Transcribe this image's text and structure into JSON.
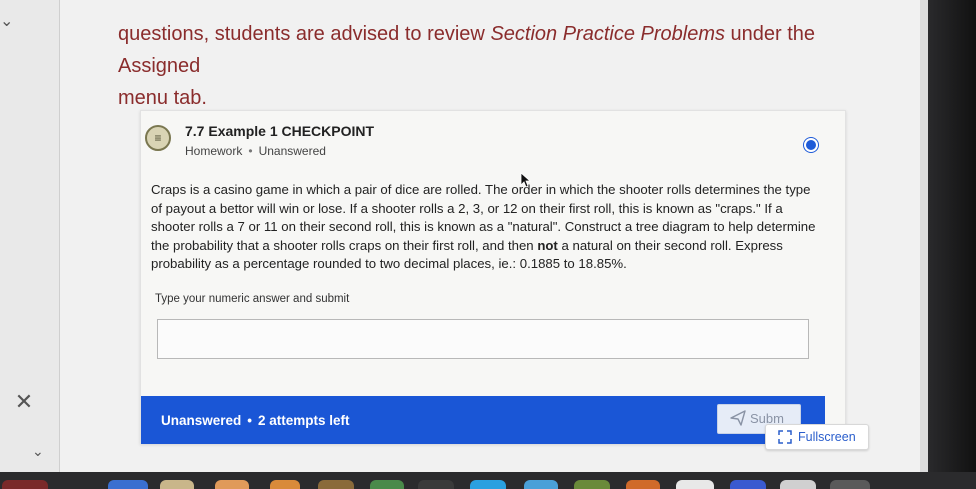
{
  "intro": {
    "line1_prefix": "questions, students are advised to review ",
    "line1_emph": "Section Practice Problems",
    "line1_suffix": " under the Assigned",
    "line2": "menu tab."
  },
  "card": {
    "title": "7.7 Example 1 CHECKPOINT",
    "type": "Homework",
    "status": "Unanswered",
    "question_part1": "Craps is a casino game in which a pair of dice are rolled. The order in which the shooter rolls determines the type of payout a bettor will win or lose. If a shooter rolls a 2, 3, or 12 on their first roll, this is known as \"craps.\" If a shooter rolls a 7 or 11 on their second roll, this is known as a \"natural\". Construct a tree diagram to help determine the probability that a shooter rolls craps on their first roll, and then ",
    "question_bold": "not",
    "question_part2": " a natural on their second roll. Express probability as a percentage rounded to two decimal places, ie.: 0.1885 to 18.85%.",
    "answer_label": "Type your numeric answer and submit",
    "answer_value": ""
  },
  "footer": {
    "status": "Unanswered",
    "attempts": "2 attempts left",
    "submit_label": "Subm",
    "fullscreen_label": "Fullscreen"
  },
  "colors": {
    "accent": "#1a56d6",
    "intro_text": "#8a2c2c"
  },
  "icons": {
    "left_chevron_top": "chevron-down-icon",
    "close": "close-icon",
    "left_chevron_bottom": "chevron-down-icon",
    "card": "list-icon",
    "submit": "send-icon",
    "fullscreen": "expand-icon"
  }
}
